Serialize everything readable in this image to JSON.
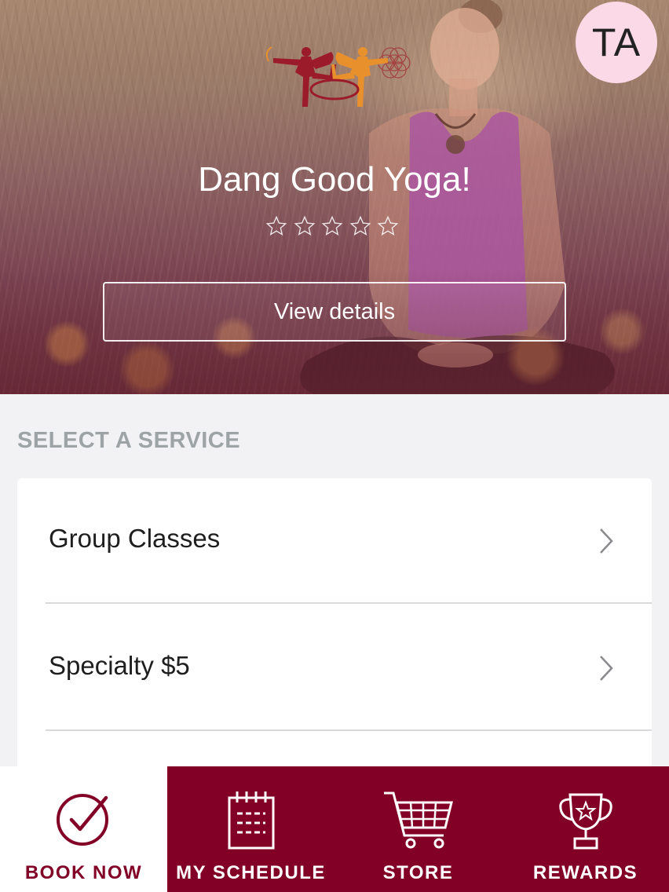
{
  "header": {
    "avatar_initials": "TA",
    "studio_name": "Dang Good Yoga!",
    "rating": 0,
    "rating_max": 5,
    "view_details_label": "View details"
  },
  "services": {
    "section_title": "SELECT A SERVICE",
    "items": [
      {
        "label": "Group Classes"
      },
      {
        "label": "Specialty $5"
      }
    ]
  },
  "bottom_nav": {
    "items": [
      {
        "label": "BOOK NOW",
        "icon": "check-circle-icon",
        "active": true
      },
      {
        "label": "MY SCHEDULE",
        "icon": "calendar-icon",
        "active": false
      },
      {
        "label": "STORE",
        "icon": "cart-icon",
        "active": false
      },
      {
        "label": "REWARDS",
        "icon": "trophy-icon",
        "active": false
      }
    ]
  },
  "colors": {
    "brand": "#820026",
    "avatar_bg": "#fbd9e6",
    "section_label": "#9ea4a6",
    "logo_dark_figure": "#9b1b2b",
    "logo_light_figure": "#e8912c"
  }
}
